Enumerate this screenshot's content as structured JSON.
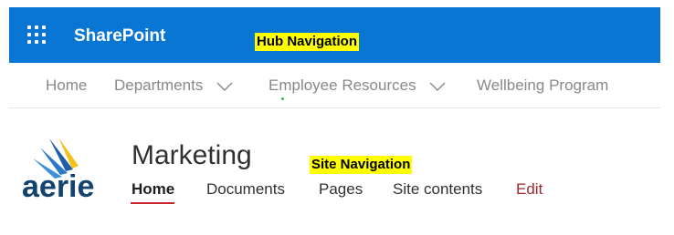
{
  "suite_bar": {
    "app_title": "SharePoint",
    "waffle_icon": "app-launcher-icon",
    "background_color": "#0a76d4"
  },
  "annotations": {
    "hub": "Hub Navigation",
    "site": "Site Navigation",
    "highlight_color": "#ffff00"
  },
  "hub_nav": {
    "items": [
      {
        "label": "Home",
        "has_dropdown": false
      },
      {
        "label": "Departments",
        "has_dropdown": true
      },
      {
        "label": "Employee Resources",
        "has_dropdown": true
      },
      {
        "label": "Wellbeing Program",
        "has_dropdown": false
      }
    ],
    "dropdown_icon": "chevron-down-icon"
  },
  "site": {
    "logo_text": "aerie",
    "title": "Marketing",
    "nav": [
      {
        "label": "Home",
        "selected": true
      },
      {
        "label": "Documents",
        "selected": false
      },
      {
        "label": "Pages",
        "selected": false
      },
      {
        "label": "Site contents",
        "selected": false
      },
      {
        "label": "Edit",
        "selected": false
      }
    ],
    "accent_color": "#c4262c"
  }
}
